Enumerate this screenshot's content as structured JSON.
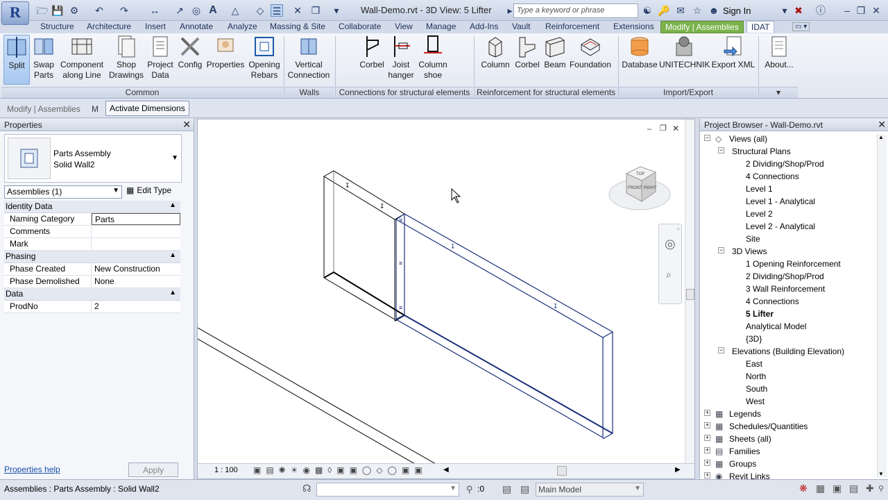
{
  "window": {
    "title": "Wall-Demo.rvt - 3D View: 5 Lifter"
  },
  "search": {
    "placeholder": "Type a keyword or phrase"
  },
  "account": {
    "signin": "Sign In"
  },
  "tabs": [
    "Structure",
    "Architecture",
    "Insert",
    "Annotate",
    "Analyze",
    "Massing & Site",
    "Collaborate",
    "View",
    "Manage",
    "Add-Ins",
    "Vault",
    "Reinforcement",
    "Extensions",
    "Modify | Assemblies",
    "IDAT"
  ],
  "ribbon": {
    "common": {
      "label": "Common",
      "tools": [
        {
          "l1": "Split",
          "l2": ""
        },
        {
          "l1": "Swap",
          "l2": "Parts"
        },
        {
          "l1": "Component",
          "l2": "along Line"
        },
        {
          "l1": "Shop",
          "l2": "Drawings"
        },
        {
          "l1": "Project",
          "l2": "Data"
        },
        {
          "l1": "Config",
          "l2": ""
        },
        {
          "l1": "Properties",
          "l2": ""
        },
        {
          "l1": "Opening",
          "l2": "Rebars"
        }
      ]
    },
    "walls": {
      "label": "Walls",
      "tools": [
        {
          "l1": "Vertical",
          "l2": "Connection"
        }
      ]
    },
    "connections": {
      "label": "Connections for structural elements",
      "tools": [
        {
          "l1": "Corbel",
          "l2": ""
        },
        {
          "l1": "Joist",
          "l2": "hanger"
        },
        {
          "l1": "Column",
          "l2": "shoe"
        }
      ]
    },
    "reinforcement": {
      "label": "Reinforcement for structural elements",
      "tools": [
        {
          "l1": "Column",
          "l2": ""
        },
        {
          "l1": "Corbel",
          "l2": ""
        },
        {
          "l1": "Beam",
          "l2": ""
        },
        {
          "l1": "Foundation",
          "l2": ""
        }
      ]
    },
    "importexport": {
      "label": "Import/Export",
      "tools": [
        {
          "l1": "Database",
          "l2": ""
        },
        {
          "l1": "UNITECHNIK",
          "l2": ""
        },
        {
          "l1": "Export XML",
          "l2": ""
        }
      ]
    },
    "about": {
      "tools": [
        {
          "l1": "About...",
          "l2": ""
        }
      ]
    }
  },
  "optionsbar": {
    "context": "Modify | Assemblies",
    "short": "M",
    "activate": "Activate Dimensions"
  },
  "properties": {
    "title": "Properties",
    "type_line1": "Parts Assembly",
    "type_line2": "Solid Wall2",
    "filter": "Assemblies (1)",
    "edit_type": "Edit Type",
    "groups": [
      {
        "name": "Identity Data",
        "rows": [
          {
            "k": "Naming Category",
            "v": "Parts"
          },
          {
            "k": "Comments",
            "v": ""
          },
          {
            "k": "Mark",
            "v": ""
          }
        ]
      },
      {
        "name": "Phasing",
        "rows": [
          {
            "k": "Phase Created",
            "v": "New Construction"
          },
          {
            "k": "Phase Demolished",
            "v": "None"
          }
        ]
      },
      {
        "name": "Data",
        "rows": [
          {
            "k": "ProdNo",
            "v": "2"
          }
        ]
      }
    ],
    "help": "Properties help",
    "apply": "Apply"
  },
  "view": {
    "scale": "1 : 100",
    "cube_right": "RIGHT",
    "cube_front": "FRONT",
    "cube_top": "TOP"
  },
  "browser": {
    "title": "Project Browser - Wall-Demo.rvt",
    "nodes": [
      {
        "t": "Views (all)",
        "lvl": 0
      },
      {
        "t": "Structural Plans",
        "lvl": 1
      },
      {
        "t": "2 Dividing/Shop/Prod",
        "lvl": 2
      },
      {
        "t": "4 Connections",
        "lvl": 2
      },
      {
        "t": "Level 1",
        "lvl": 2
      },
      {
        "t": "Level 1 - Analytical",
        "lvl": 2
      },
      {
        "t": "Level 2",
        "lvl": 2
      },
      {
        "t": "Level 2 - Analytical",
        "lvl": 2
      },
      {
        "t": "Site",
        "lvl": 2
      },
      {
        "t": "3D Views",
        "lvl": 1
      },
      {
        "t": "1 Opening Reinforcement",
        "lvl": 2
      },
      {
        "t": "2 Dividing/Shop/Prod",
        "lvl": 2
      },
      {
        "t": "3 Wall Reinforcement",
        "lvl": 2
      },
      {
        "t": "4 Connections",
        "lvl": 2
      },
      {
        "t": "5 Lifter",
        "lvl": 2,
        "bold": true
      },
      {
        "t": "Analytical Model",
        "lvl": 2
      },
      {
        "t": "{3D}",
        "lvl": 2
      },
      {
        "t": "Elevations (Building Elevation)",
        "lvl": 1
      },
      {
        "t": "East",
        "lvl": 2
      },
      {
        "t": "North",
        "lvl": 2
      },
      {
        "t": "South",
        "lvl": 2
      },
      {
        "t": "West",
        "lvl": 2
      },
      {
        "t": "Legends",
        "lvl": 0
      },
      {
        "t": "Schedules/Quantities",
        "lvl": 0
      },
      {
        "t": "Sheets (all)",
        "lvl": 0
      },
      {
        "t": "Families",
        "lvl": 0
      },
      {
        "t": "Groups",
        "lvl": 0
      },
      {
        "t": "Revit Links",
        "lvl": 0
      }
    ]
  },
  "status": {
    "text": "Assemblies : Parts Assembly : Solid Wall2",
    "sel_count": ":0",
    "model": "Main Model"
  }
}
